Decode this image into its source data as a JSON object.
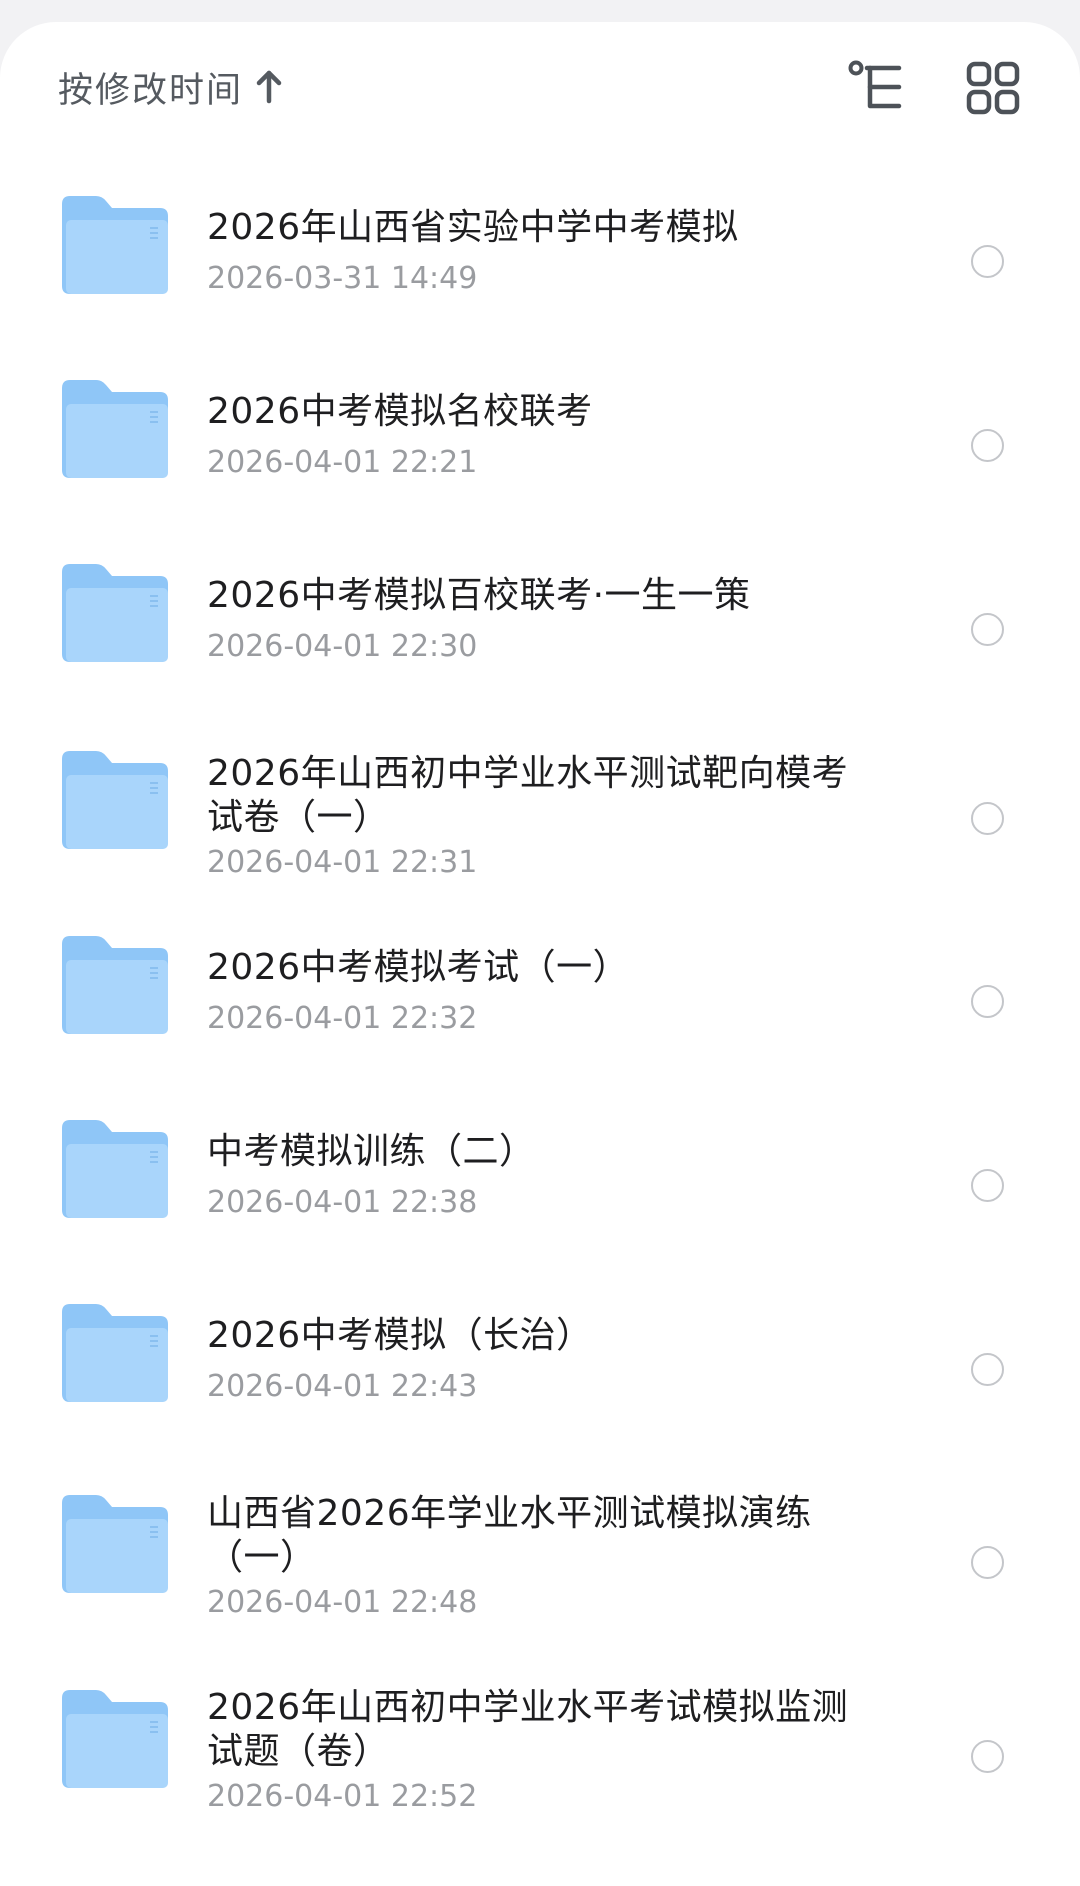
{
  "header": {
    "sort_label": "按修改时间",
    "sort_icon": "arrow-up-icon",
    "tree_icon": "tree-view-icon",
    "grid_icon": "grid-view-icon"
  },
  "colors": {
    "folder_top": "#8fc6f7",
    "folder_body": "#a9d5fb",
    "text_primary": "#1e1e20",
    "text_secondary": "#9a9ca0",
    "radio_border": "#c4c6ca"
  },
  "files": [
    {
      "name": "2026年山西省实验中学中考模拟",
      "date": "2026-03-31 14:49"
    },
    {
      "name": "2026中考模拟名校联考",
      "date": "2026-04-01 22:21"
    },
    {
      "name": "2026中考模拟百校联考·一生一策",
      "date": "2026-04-01 22:30"
    },
    {
      "name": "2026年山西初中学业水平测试靶向模考试卷（一）",
      "date": "2026-04-01 22:31"
    },
    {
      "name": "2026中考模拟考试（一）",
      "date": "2026-04-01 22:32"
    },
    {
      "name": "中考模拟训练（二）",
      "date": "2026-04-01 22:38"
    },
    {
      "name": "2026中考模拟（长治）",
      "date": "2026-04-01 22:43"
    },
    {
      "name": "山西省2026年学业水平测试模拟演练（一）",
      "date": "2026-04-01 22:48"
    },
    {
      "name": "2026年山西初中学业水平考试模拟监测试题（卷）",
      "date": "2026-04-01 22:52"
    }
  ]
}
